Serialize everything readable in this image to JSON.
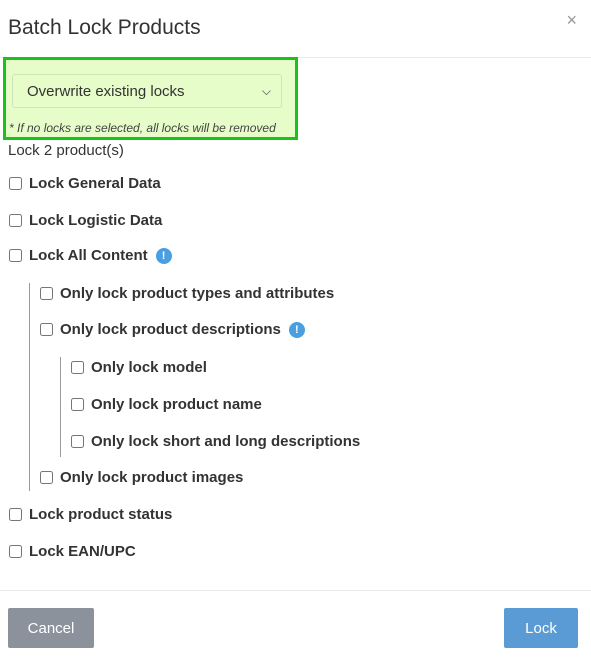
{
  "modal": {
    "title": "Batch Lock Products",
    "close_glyph": "×"
  },
  "mode": {
    "selected": "Overwrite existing locks",
    "note": "* If no locks are selected, all locks will be removed"
  },
  "count_text": "Lock 2 product(s)",
  "options": {
    "general": "Lock General Data",
    "logistic": "Lock Logistic Data",
    "all_content": "Lock All Content",
    "types_attrs": "Only lock product types and attributes",
    "descriptions": "Only lock product descriptions",
    "model": "Only lock model",
    "name": "Only lock product name",
    "short_long": "Only lock short and long descriptions",
    "images": "Only lock product images",
    "status": "Lock product status",
    "ean": "Lock EAN/UPC"
  },
  "footer": {
    "cancel": "Cancel",
    "lock": "Lock"
  },
  "colors": {
    "highlight_border": "#1cc21c",
    "highlight_bg": "#e6fcc9",
    "primary": "#5a9bd5",
    "secondary": "#8b929c",
    "info": "#4a9fe0"
  },
  "icons": [
    "close-icon",
    "chevron-down-icon",
    "info-icon"
  ]
}
